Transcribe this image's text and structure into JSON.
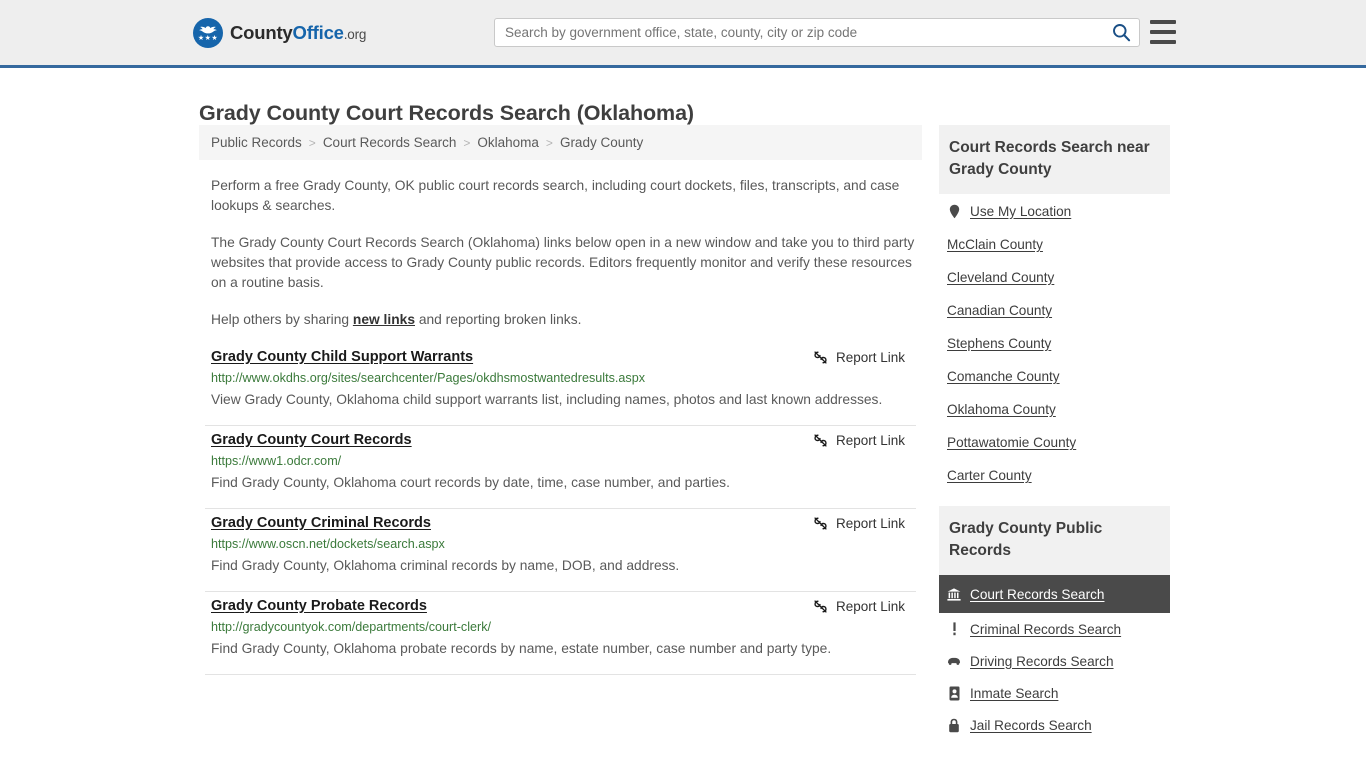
{
  "header": {
    "logo": {
      "text_part1": "County",
      "text_part2": "Office",
      "text_part3": ".org",
      "icon": "eagle-seal-icon"
    },
    "search": {
      "placeholder": "Search by government office, state, county, city or zip code",
      "value": "",
      "button_icon": "search-icon"
    },
    "menu_icon": "hamburger-menu-icon"
  },
  "page": {
    "title": "Grady County Court Records Search (Oklahoma)"
  },
  "breadcrumb": {
    "separator": ">",
    "items": [
      {
        "label": "Public Records"
      },
      {
        "label": "Court Records Search"
      },
      {
        "label": "Oklahoma"
      },
      {
        "label": "Grady County"
      }
    ]
  },
  "intro": {
    "p1": "Perform a free Grady County, OK public court records search, including court dockets, files, transcripts, and case lookups & searches.",
    "p2": "The Grady County Court Records Search (Oklahoma) links below open in a new window and take you to third party websites that provide access to Grady County public records. Editors frequently monitor and verify these resources on a routine basis.",
    "p3_before": "Help others by sharing ",
    "p3_link": "new links",
    "p3_after": " and reporting broken links."
  },
  "results": {
    "report_label": "Report Link",
    "report_icon": "broken-link-icon",
    "items": [
      {
        "title": "Grady County Child Support Warrants",
        "url": "http://www.okdhs.org/sites/searchcenter/Pages/okdhsmostwantedresults.aspx",
        "description": "View Grady County, Oklahoma child support warrants list, including names, photos and last known addresses."
      },
      {
        "title": "Grady County Court Records",
        "url": "https://www1.odcr.com/",
        "description": "Find Grady County, Oklahoma court records by date, time, case number, and parties."
      },
      {
        "title": "Grady County Criminal Records",
        "url": "https://www.oscn.net/dockets/search.aspx",
        "description": "Find Grady County, Oklahoma criminal records by name, DOB, and address."
      },
      {
        "title": "Grady County Probate Records",
        "url": "http://gradycountyok.com/departments/court-clerk/",
        "description": "Find Grady County, Oklahoma probate records by name, estate number, case number and party type."
      }
    ]
  },
  "sidebar": {
    "nearby": {
      "heading": "Court Records Search near Grady County",
      "items": [
        {
          "label": "Use My Location",
          "icon": "map-pin-icon"
        },
        {
          "label": "McClain County",
          "icon": ""
        },
        {
          "label": "Cleveland County",
          "icon": ""
        },
        {
          "label": "Canadian County",
          "icon": ""
        },
        {
          "label": "Stephens County",
          "icon": ""
        },
        {
          "label": "Comanche County",
          "icon": ""
        },
        {
          "label": "Oklahoma County",
          "icon": ""
        },
        {
          "label": "Pottawatomie County",
          "icon": ""
        },
        {
          "label": "Carter County",
          "icon": ""
        }
      ]
    },
    "public_records": {
      "heading": "Grady County Public Records",
      "items": [
        {
          "label": "Court Records Search",
          "icon": "courthouse-icon",
          "active": true
        },
        {
          "label": "Criminal Records Search",
          "icon": "exclamation-icon",
          "active": false
        },
        {
          "label": "Driving Records Search",
          "icon": "car-icon",
          "active": false
        },
        {
          "label": "Inmate Search",
          "icon": "id-badge-icon",
          "active": false
        },
        {
          "label": "Jail Records Search",
          "icon": "lock-icon",
          "active": false
        }
      ]
    }
  },
  "colors": {
    "brand_blue": "#1665ab",
    "header_bg": "#eeeeee",
    "header_border": "#35699e",
    "url_green": "#3b7a3b",
    "active_bg": "#4a4a4a",
    "panel_bg": "#f1f1f1"
  }
}
